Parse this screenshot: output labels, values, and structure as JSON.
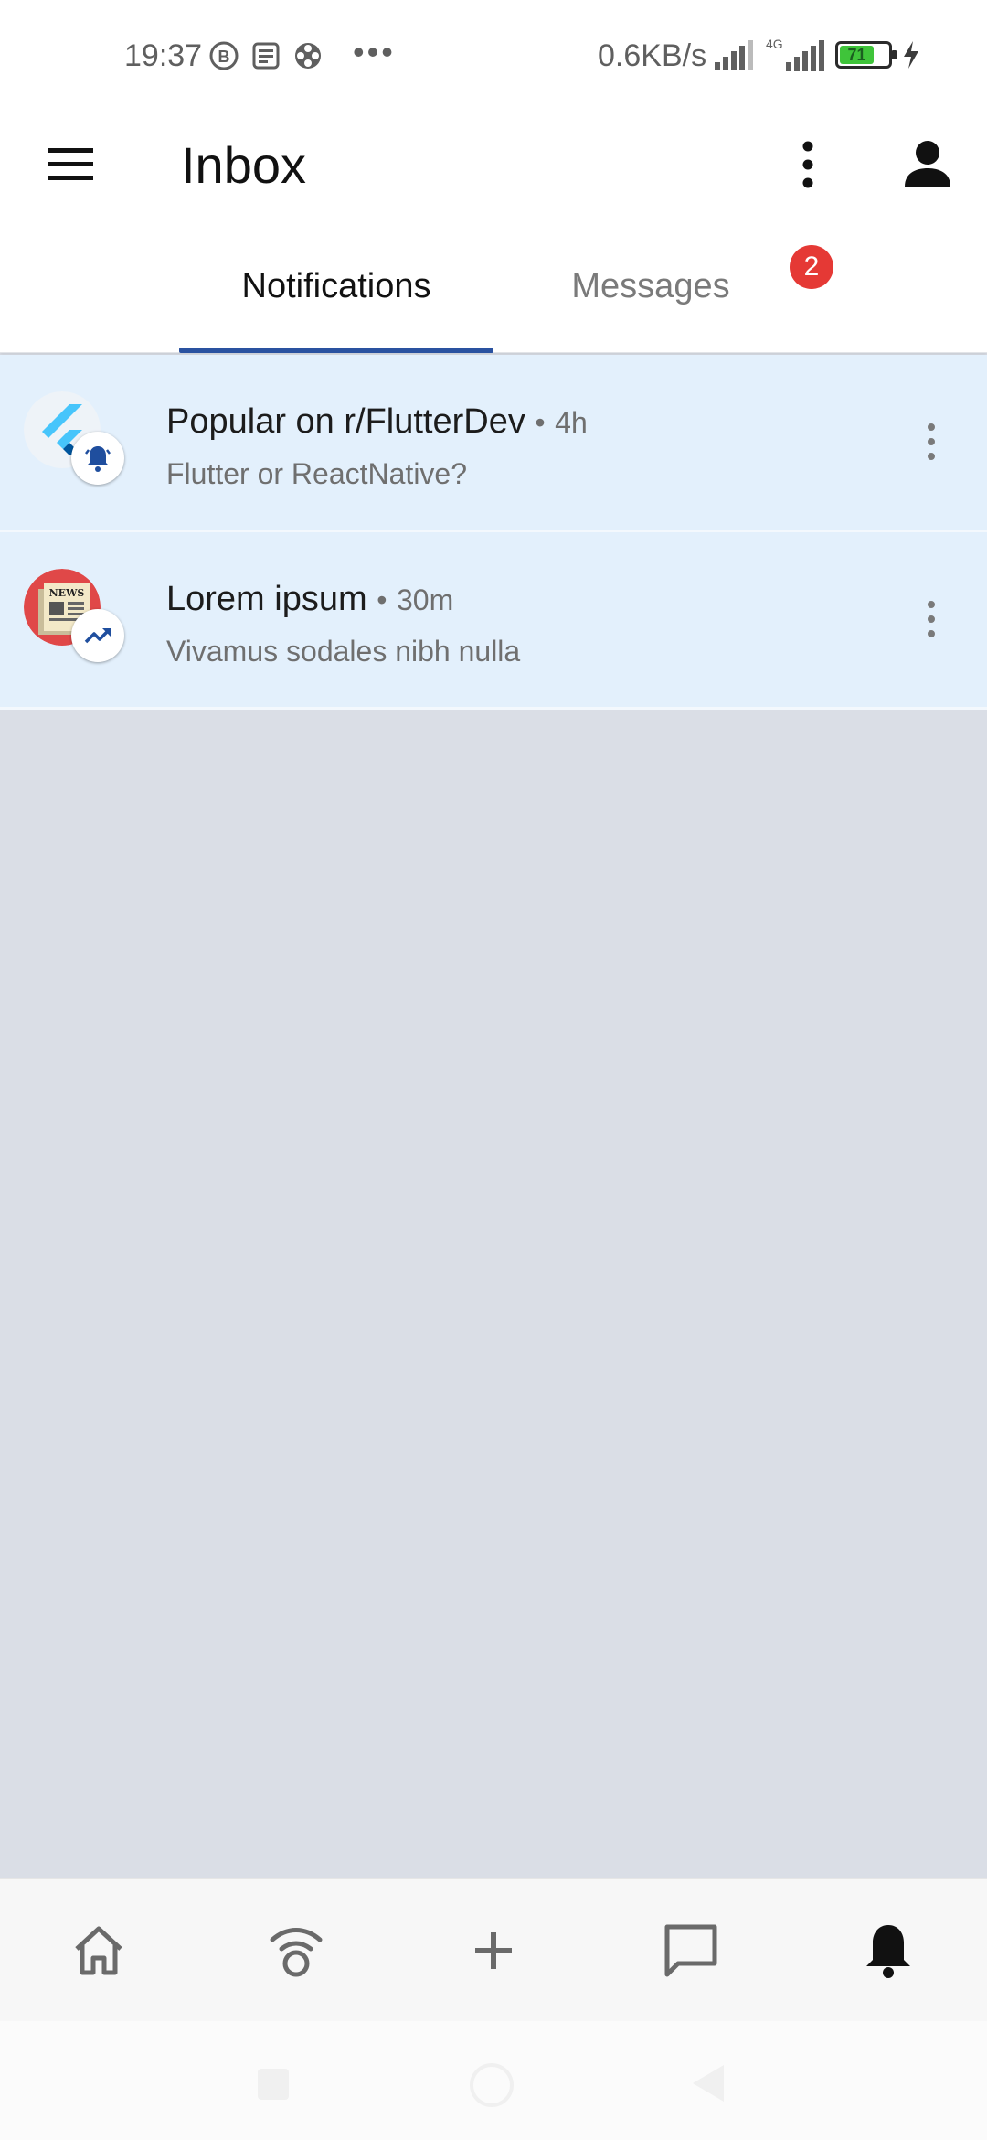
{
  "status_bar": {
    "time": "19:37",
    "network_speed": "0.6KB/s",
    "network_type": "4G",
    "battery_level": "71",
    "battery_color": "#3fc43a",
    "icons": [
      "b-circle-icon",
      "news-icon",
      "gear-flower-icon",
      "ellipsis-icon",
      "signal-icon",
      "signal-4g-icon",
      "battery-icon",
      "charging-icon"
    ]
  },
  "app_bar": {
    "title": "Inbox",
    "icons": [
      "menu-icon",
      "more-vert-icon",
      "account-icon"
    ]
  },
  "tabs": {
    "items": [
      {
        "label": "Notifications",
        "selected": true
      },
      {
        "label": "Messages",
        "selected": false,
        "badge": "2"
      }
    ],
    "indicator_color": "#2a52a0",
    "badge_color": "#e53935"
  },
  "notifications": [
    {
      "title": "Popular on r/FlutterDev",
      "time": "4h",
      "subtitle": "Flutter or ReactNative?",
      "avatar_icon": "flutter-logo-icon",
      "badge_icon": "bell-icon"
    },
    {
      "title": "Lorem ipsum",
      "time": "30m",
      "subtitle": "Vivamus sodales nibh nulla",
      "avatar_icon": "newspaper-icon",
      "badge_icon": "trending-up-icon"
    }
  ],
  "separator": "•",
  "bottom_nav": {
    "items": [
      "home-icon",
      "community-icon",
      "add-icon",
      "chat-icon",
      "bell-icon"
    ],
    "active": "bell-icon"
  },
  "colors": {
    "unread_background": "#e3f0fc",
    "page_background": "#dadee6"
  }
}
